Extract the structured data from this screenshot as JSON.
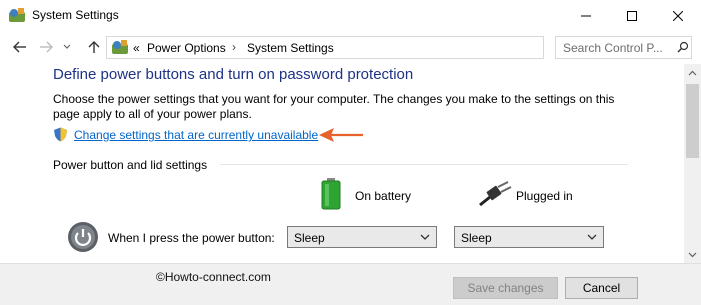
{
  "window": {
    "title": "System Settings",
    "app_icon": "control-panel-icon"
  },
  "nav": {
    "back_icon": "arrow-left-icon",
    "forward_icon": "arrow-right-icon",
    "recent_icon": "chevron-down-icon",
    "up_icon": "arrow-up-icon",
    "breadcrumb_overflow": "«",
    "breadcrumb": [
      "Power Options",
      "System Settings"
    ],
    "search_placeholder": "Search Control P..."
  },
  "main": {
    "title": "Define power buttons and turn on password protection",
    "description": "Choose the power settings that you want for your computer. The changes you make to the settings on this page apply to all of your power plans.",
    "change_link": "Change settings that are currently unavailable",
    "section_heading": "Power button and lid settings",
    "columns": {
      "battery": "On battery",
      "plugged": "Plugged in"
    },
    "rows": [
      {
        "label": "When I press the power button:",
        "battery_value": "Sleep",
        "plugged_value": "Sleep"
      }
    ]
  },
  "footer": {
    "watermark": "©Howto-connect.com",
    "save_label": "Save changes",
    "cancel_label": "Cancel"
  },
  "colors": {
    "title": "#1e3287",
    "link": "#0066cc",
    "arrow": "#e8632b",
    "battery": "#2ea532"
  }
}
